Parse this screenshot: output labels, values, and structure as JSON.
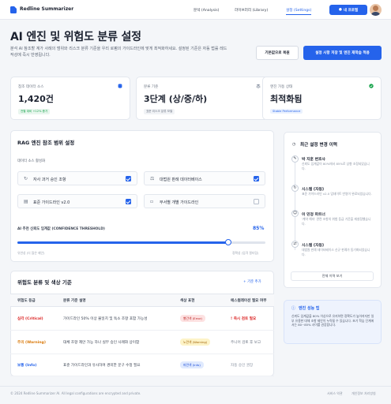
{
  "app": {
    "title": "Redline Summarizer"
  },
  "nav": {
    "items": [
      {
        "label": "분석 (Analysis)",
        "active": false
      },
      {
        "label": "라이브러리 (Library)",
        "active": false
      },
      {
        "label": "설정 (Settings)",
        "active": true
      }
    ],
    "profile_label": "내 프로필"
  },
  "header": {
    "title": "AI 엔진 및 위험도 분류 설정",
    "description": "분석 AI 참조할 계가 사례의 범위와 리스크 분류 기준을 우리 로펌의 가이드라인에 맞게 최적화하세요. 설정된 기준은 자동 법률 레드 작성에 즉시 반영됩니다.",
    "reset_label": "기본값으로 복원",
    "save_label": "설정 사항 저장 및 엔진 재학습 적용"
  },
  "stats": [
    {
      "label": "참조 데이터 소스",
      "value": "1,420건",
      "sub": "전월 대비 +12% 증가",
      "sub_color": "#16a34a",
      "sub_bg": "#e8f6ee",
      "icon": "database-icon"
    },
    {
      "label": "분류 기준",
      "value": "3단계 (상/중/하)",
      "sub": "표준 리스크 분류 모델",
      "sub_color": "#6b7483",
      "sub_bg": "#f1f3f6",
      "icon": "layers-icon"
    },
    {
      "label": "엔진 가동 상태",
      "value": "최적화됨",
      "sub": "Stable Performance",
      "sub_color": "#2563eb",
      "sub_bg": "#eaf1fe",
      "icon": "check-circle-icon"
    }
  ],
  "rag": {
    "title": "RAG 엔진 참조 범위 설정",
    "sources_label": "데이터 소스 활성화",
    "sources": [
      {
        "label": "자사 과거 승인 조항",
        "checked": true,
        "icon": "history-icon"
      },
      {
        "label": "대법원 판례 데이터베이스",
        "checked": true,
        "icon": "scale-icon"
      },
      {
        "label": "표준 가이드라인 v2.0",
        "checked": true,
        "icon": "document-icon"
      },
      {
        "label": "부서별 개별 가이드라인",
        "checked": false,
        "icon": "folder-icon"
      }
    ],
    "threshold_label": "AI 추천 신뢰도 임계값 (CONFIDENCE THRESHOLD)",
    "threshold_value": 0.85,
    "threshold_text": "85%",
    "min_label": "유연성 (더 많은 제안)",
    "max_label": "정확성 (엄격 필터링)"
  },
  "risk": {
    "title": "위험도 분류 및 색상 기준",
    "add_label": "+ 기준 추가",
    "columns": [
      "위험도 등급",
      "분류 기준 설명",
      "색상 표현",
      "에스컬레이션 필요 여부"
    ],
    "rows": [
      {
        "grade": "심각 (Critical)",
        "grade_color": "#dc2626",
        "desc": "가이드라인 50% 이상 불일치 및 독소 조항 포함 가능성",
        "badge": "빨간색 (Error)",
        "badge_color": "#b91c1c",
        "badge_bg": "#fde2e2",
        "escalation": "즉시 검토 필요",
        "esc_color": "#dc2626",
        "esc_icon": "!"
      },
      {
        "grade": "주의 (Warning)",
        "grade_color": "#d97706",
        "desc": "대체 조항 제안 가능 하나 실무 승인 사례와 상이함",
        "badge": "노란색 (Warning)",
        "badge_color": "#a16207",
        "badge_bg": "#fdf3c7",
        "escalation": "주니어 검토 후 보고",
        "esc_color": "#6b7483",
        "esc_icon": ""
      },
      {
        "grade": "보통 (Info)",
        "grade_color": "#2563eb",
        "desc": "표준 가이드라인과 유사하며 경미한 문구 수정 필요",
        "badge": "파란색 (Info)",
        "badge_color": "#1d4ed8",
        "badge_bg": "#e0eafe",
        "escalation": "자동 승인 권장",
        "esc_color": "#8a93a2",
        "esc_icon": ""
      }
    ]
  },
  "history": {
    "title": "최근 설정 변경 이력",
    "items": [
      {
        "title": "박 지훈 변호사",
        "desc": "신뢰도 임계값이 80%에서 85%로 상향 조정되었습니다.",
        "icon": "edit-icon"
      },
      {
        "title": "시스템 (자동)",
        "desc": "표준 가이드라인 v2.0 업데이트 반영이 완료되었습니다.",
        "icon": "refresh-icon"
      },
      {
        "title": "이 민정 파트너",
        "desc": "'계약 해지' 관련 조항의 위험 등급 기준을 재설정했습니다.",
        "icon": "user-icon"
      },
      {
        "title": "시스템 (자동)",
        "desc": "대법원 판례 데이터베이스 신규 판례가 동기화되었습니다.",
        "icon": "sync-icon"
      }
    ],
    "view_all_label": "전체 이력 보기"
  },
  "tip": {
    "title": "엔진 성능 팁",
    "text": "신뢰도 임계값을 80% 이상으로 유지하면 정확도가 높아지지만 일부 유용한 대체 조항 제안이 누락될 수 있습니다. 초기 학습 단계에서는 80~85% 사이를 권장합니다."
  },
  "footer": {
    "copyright": "© 2024 Redline Summarizer AI. All legal configurations are encrypted and private.",
    "links": [
      "서비스 약관",
      "개인정보 처리방침"
    ]
  }
}
